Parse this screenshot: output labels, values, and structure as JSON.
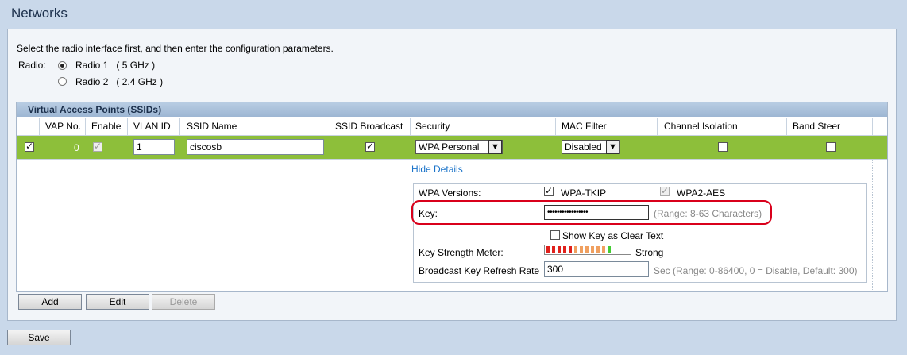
{
  "page_title": "Networks",
  "instructions": "Select the radio interface first, and then enter the configuration parameters.",
  "radio": {
    "label": "Radio:",
    "options": [
      {
        "label": "Radio 1",
        "band": "( 5 GHz )",
        "selected": true
      },
      {
        "label": "Radio 2",
        "band": "( 2.4 GHz )",
        "selected": false
      }
    ]
  },
  "vap": {
    "section_title": "Virtual Access Points (SSIDs)",
    "columns": [
      "VAP No.",
      "Enable",
      "VLAN ID",
      "SSID Name",
      "SSID Broadcast",
      "Security",
      "MAC Filter",
      "Channel Isolation",
      "Band Steer"
    ],
    "row": {
      "vap_no": "0",
      "vlan_id": "1",
      "ssid_name": "ciscosb",
      "security": "WPA Personal",
      "mac_filter": "Disabled"
    },
    "hide_details": "Hide Details"
  },
  "details": {
    "wpa_versions_label": "WPA Versions:",
    "wpa_tkip": "WPA-TKIP",
    "wpa2_aes": "WPA2-AES",
    "key_label": "Key:",
    "key_value": "•••••••••••••••••",
    "key_range": "(Range: 8-63 Characters)",
    "show_key_label": "Show Key as Clear Text",
    "strength_label": "Key Strength Meter:",
    "strength_text": "Strong",
    "strength_level": 0.8,
    "refresh_label": "Broadcast Key Refresh Rate",
    "refresh_value": "300",
    "refresh_hint": "Sec (Range: 0-86400, 0 = Disable, Default: 300)"
  },
  "buttons": {
    "add": "Add",
    "edit": "Edit",
    "delete": "Delete",
    "save": "Save"
  },
  "colors": {
    "selected_row": "#8dbf3a",
    "highlight": "#d9001b",
    "link": "#1a73c9"
  }
}
